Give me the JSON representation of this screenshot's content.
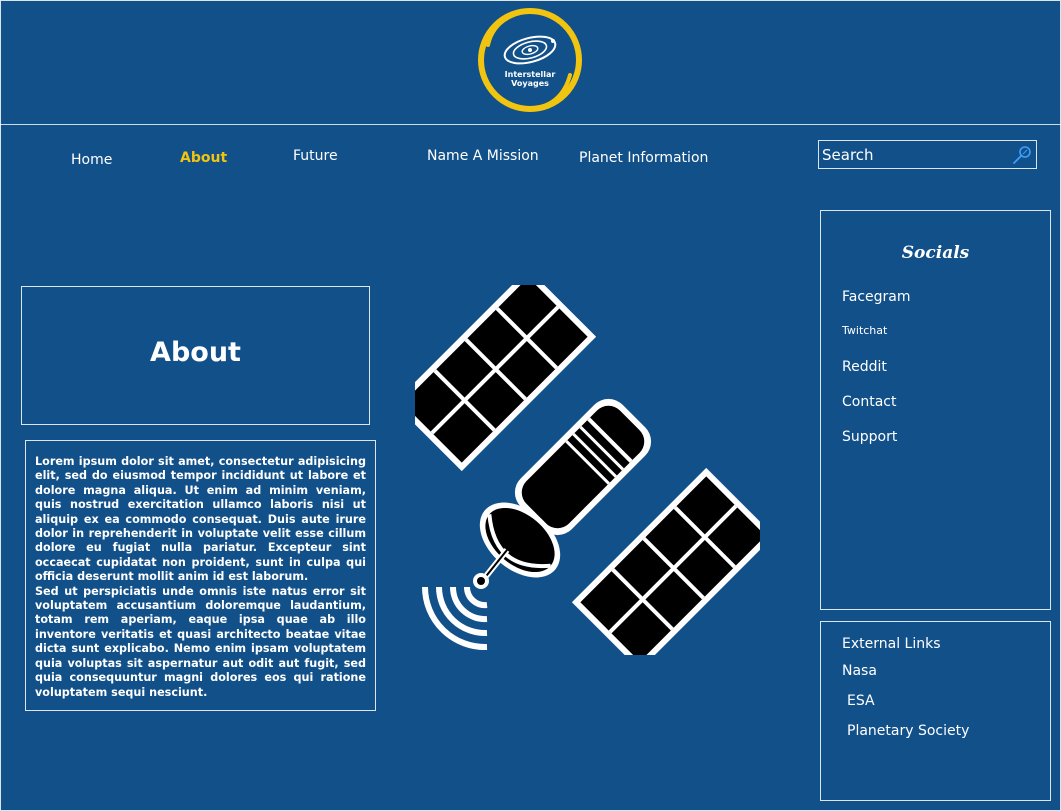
{
  "logo": {
    "text_line1": "Interstellar",
    "text_line2": "Voyages",
    "accent": "#f1c40f"
  },
  "nav": {
    "items": [
      {
        "label": "Home",
        "active": false
      },
      {
        "label": "About",
        "active": true
      },
      {
        "label": "Future",
        "active": false
      },
      {
        "label": "Name A Mission",
        "active": false
      },
      {
        "label": "Planet Information",
        "active": false
      }
    ]
  },
  "search": {
    "placeholder": "Search",
    "icon": "search-icon"
  },
  "about": {
    "title": "About",
    "paragraph1": "Lorem ipsum dolor sit amet, consectetur adipisicing elit, sed do eiusmod tempor incididunt ut labore et dolore magna aliqua. Ut enim ad minim veniam, quis nostrud exercitation ullamco laboris nisi ut aliquip ex ea commodo consequat. Duis aute irure dolor in reprehenderit in voluptate velit esse cillum dolore eu fugiat nulla pariatur. Excepteur sint occaecat cupidatat non proident, sunt in culpa qui officia deserunt mollit anim id est laborum.",
    "paragraph2": "Sed ut perspiciatis unde omnis iste natus error sit voluptatem accusantium doloremque laudantium, totam rem aperiam, eaque ipsa quae ab illo inventore veritatis et quasi architecto beatae vitae dicta sunt explicabo. Nemo enim ipsam voluptatem quia voluptas sit aspernatur aut odit aut fugit, sed quia consequuntur magni dolores eos qui ratione voluptatem sequi nesciunt."
  },
  "socials": {
    "title": "Socials",
    "items": [
      "Facegram",
      "Twitchat",
      "Reddit",
      "Contact",
      "Support"
    ]
  },
  "external_links": {
    "heading": "External Links",
    "items": [
      "Nasa",
      "ESA",
      "Planetary Society"
    ]
  },
  "colors": {
    "background": "#12508a",
    "accent": "#f1c40f",
    "text": "#ffffff"
  }
}
